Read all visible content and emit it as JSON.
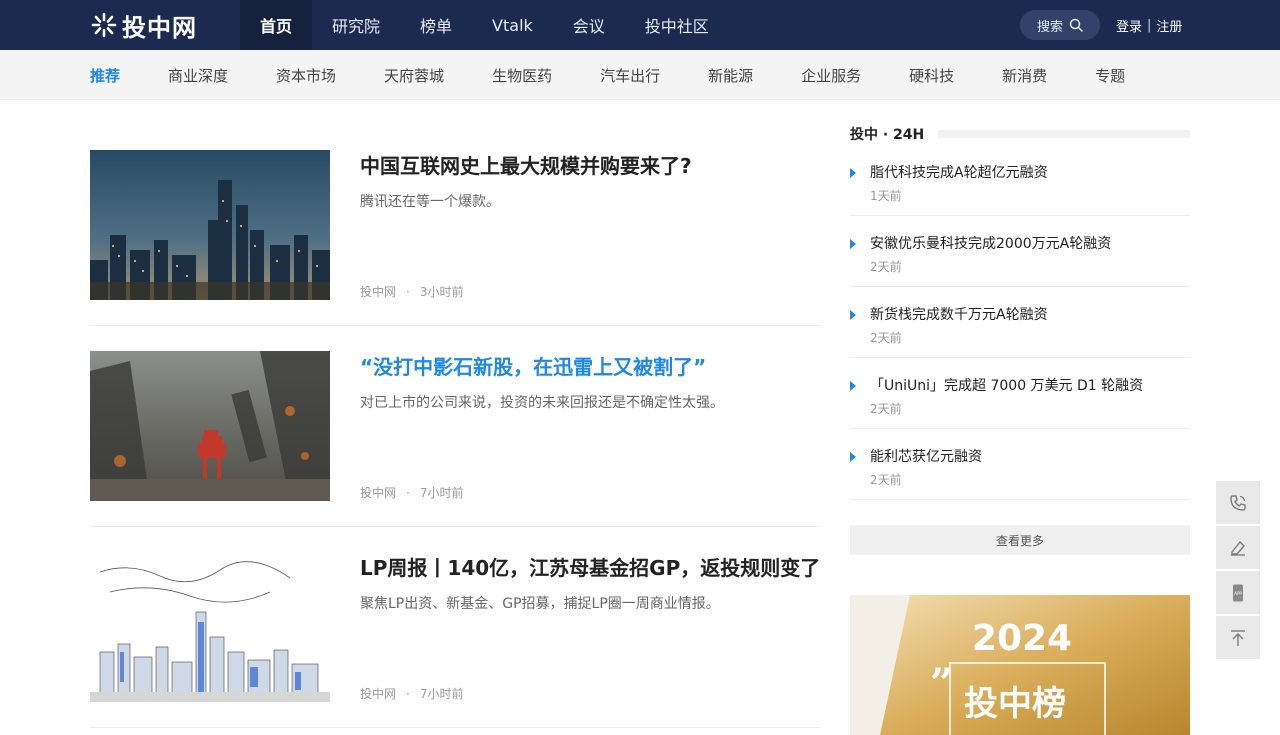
{
  "brand": {
    "name": "投中网"
  },
  "nav": {
    "items": [
      {
        "label": "首页",
        "active": true
      },
      {
        "label": "研究院",
        "active": false
      },
      {
        "label": "榜单",
        "active": false
      },
      {
        "label": "Vtalk",
        "active": false
      },
      {
        "label": "会议",
        "active": false
      },
      {
        "label": "投中社区",
        "active": false
      }
    ],
    "search_label": "搜索",
    "login": "登录",
    "separator": "|",
    "register": "注册"
  },
  "categories": [
    {
      "label": "推荐",
      "active": true
    },
    {
      "label": "商业深度",
      "active": false
    },
    {
      "label": "资本市场",
      "active": false
    },
    {
      "label": "天府蓉城",
      "active": false
    },
    {
      "label": "生物医药",
      "active": false
    },
    {
      "label": "汽车出行",
      "active": false
    },
    {
      "label": "新能源",
      "active": false
    },
    {
      "label": "企业服务",
      "active": false
    },
    {
      "label": "硬科技",
      "active": false
    },
    {
      "label": "新消费",
      "active": false
    },
    {
      "label": "专题",
      "active": false
    }
  ],
  "articles": [
    {
      "title": "中国互联网史上最大规模并购要来了?",
      "summary": "腾讯还在等一个爆款。",
      "source": "投中网",
      "time": "3小时前",
      "highlighted": false
    },
    {
      "title": "“没打中影石新股，在迅雷上又被割了”",
      "summary": "对已上市的公司来说，投资的未来回报还是不确定性太强。",
      "source": "投中网",
      "time": "7小时前",
      "highlighted": true
    },
    {
      "title": "LP周报丨140亿，江苏母基金招GP，返投规则变了",
      "summary": "聚焦LP出资、新基金、GP招募，捕捉LP圈一周商业情报。",
      "source": "投中网",
      "time": "7小时前",
      "highlighted": false
    }
  ],
  "sidebar": {
    "title": "投中 · 24H",
    "items": [
      {
        "title": "脂代科技完成A轮超亿元融资",
        "time": "1天前"
      },
      {
        "title": "安徽优乐曼科技完成2000万元A轮融资",
        "time": "2天前"
      },
      {
        "title": "新货栈完成数千万元A轮融资",
        "time": "2天前"
      },
      {
        "title": "「UniUni」完成超 7000 万美元 D1 轮融资",
        "time": "2天前"
      },
      {
        "title": "能利芯获亿元融资",
        "time": "2天前"
      }
    ],
    "more_label": "查看更多",
    "promo": {
      "year": "2024",
      "text": "投中榜"
    }
  },
  "tools": [
    {
      "icon": "phone-icon"
    },
    {
      "icon": "edit-icon"
    },
    {
      "icon": "app-icon",
      "label": "APP"
    },
    {
      "icon": "back-to-top-icon"
    }
  ],
  "colors": {
    "topbar": "#1d2a4f",
    "accent": "#1e88e5",
    "subnav": "#f4f4f4"
  }
}
